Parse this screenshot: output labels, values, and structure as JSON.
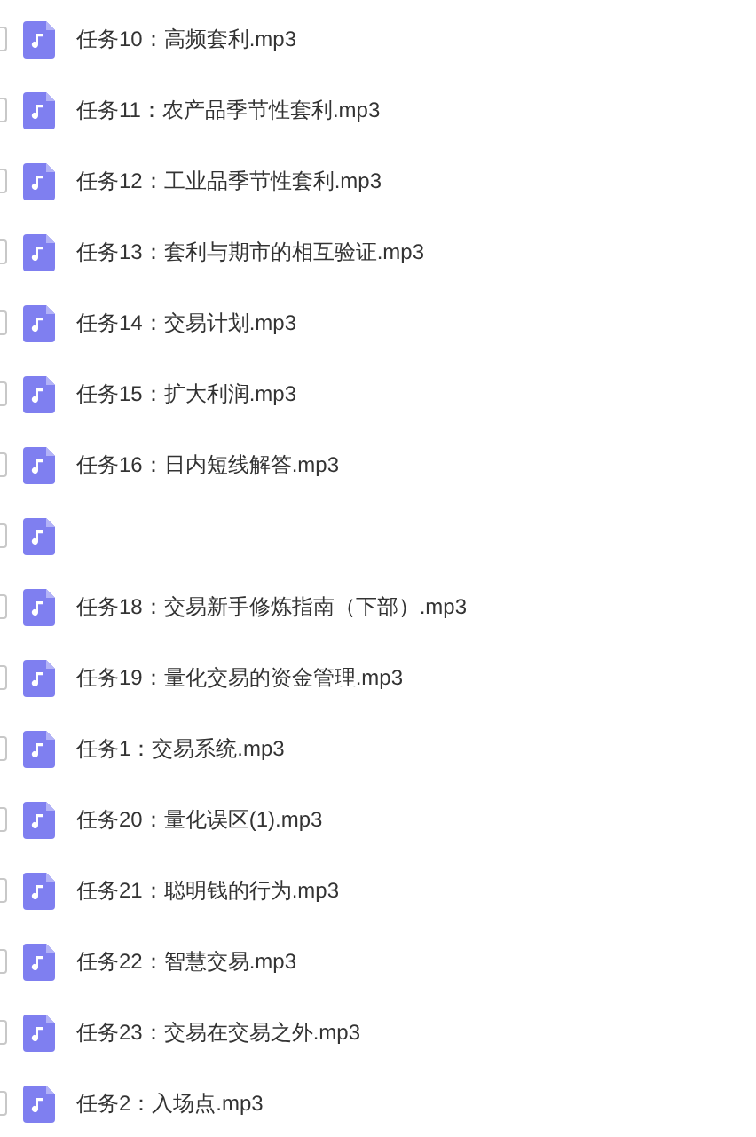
{
  "files": [
    {
      "label": "任务10：高频套利.mp3",
      "checked": false
    },
    {
      "label": "任务11：农产品季节性套利.mp3",
      "checked": false
    },
    {
      "label": "任务12：工业品季节性套利.mp3",
      "checked": false
    },
    {
      "label": "任务13：套利与期市的相互验证.mp3",
      "checked": false
    },
    {
      "label": "任务14：交易计划.mp3",
      "checked": false
    },
    {
      "label": "任务15：扩大利润.mp3",
      "checked": false
    },
    {
      "label": "任务16：日内短线解答.mp3",
      "checked": false
    },
    {
      "checked": false
    },
    {
      "label": "任务18：交易新手修炼指南（下部）.mp3",
      "checked": false
    },
    {
      "label": "任务19：量化交易的资金管理.mp3",
      "checked": false
    },
    {
      "label": "任务1：交易系统.mp3",
      "checked": false
    },
    {
      "label": "任务20：量化误区(1).mp3",
      "checked": false
    },
    {
      "label": "任务21：聪明钱的行为.mp3",
      "checked": false
    },
    {
      "label": "任务22：智慧交易.mp3",
      "checked": false
    },
    {
      "label": "任务23：交易在交易之外.mp3",
      "checked": false
    },
    {
      "label": "任务2：入场点.mp3",
      "checked": false
    }
  ]
}
